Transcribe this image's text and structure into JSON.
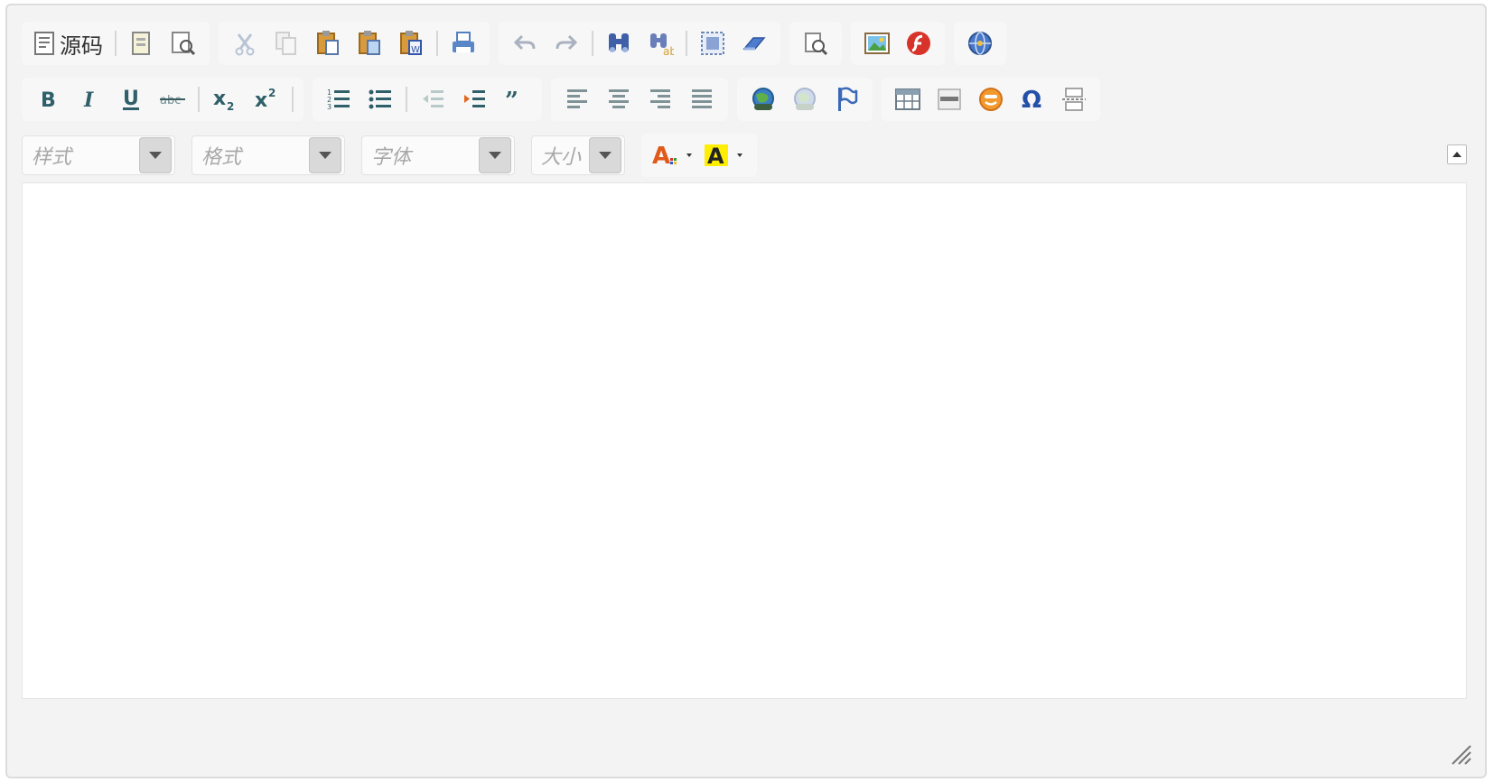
{
  "toolbar": {
    "source_label": "源码",
    "row1_icons": [
      "source-icon",
      "template-icon",
      "preview-icon",
      "cut-icon",
      "copy-icon",
      "paste-icon",
      "paste-text-icon",
      "paste-word-icon",
      "print-icon",
      "undo-icon",
      "redo-icon",
      "find-icon",
      "replace-icon",
      "select-all-icon",
      "remove-format-icon",
      "maximize-icon",
      "image-icon",
      "flash-icon",
      "globe-icon"
    ],
    "row2_icons": [
      "bold-icon",
      "italic-icon",
      "underline-icon",
      "strikethrough-icon",
      "subscript-icon",
      "superscript-icon",
      "numbered-list-icon",
      "bulleted-list-icon",
      "outdent-icon",
      "indent-icon",
      "blockquote-icon",
      "align-left-icon",
      "align-center-icon",
      "align-right-icon",
      "justify-icon",
      "link-icon",
      "unlink-icon",
      "anchor-icon",
      "table-icon",
      "horizontal-rule-icon",
      "smiley-icon",
      "special-char-icon",
      "page-break-icon"
    ]
  },
  "combos": {
    "style": "样式",
    "format": "格式",
    "font": "字体",
    "size": "大小"
  },
  "colors": {
    "text_color": "#e05a1a",
    "bg_color": "#ffee00",
    "accent_blue": "#2d5db3",
    "accent_teal": "#2f7f7a"
  }
}
